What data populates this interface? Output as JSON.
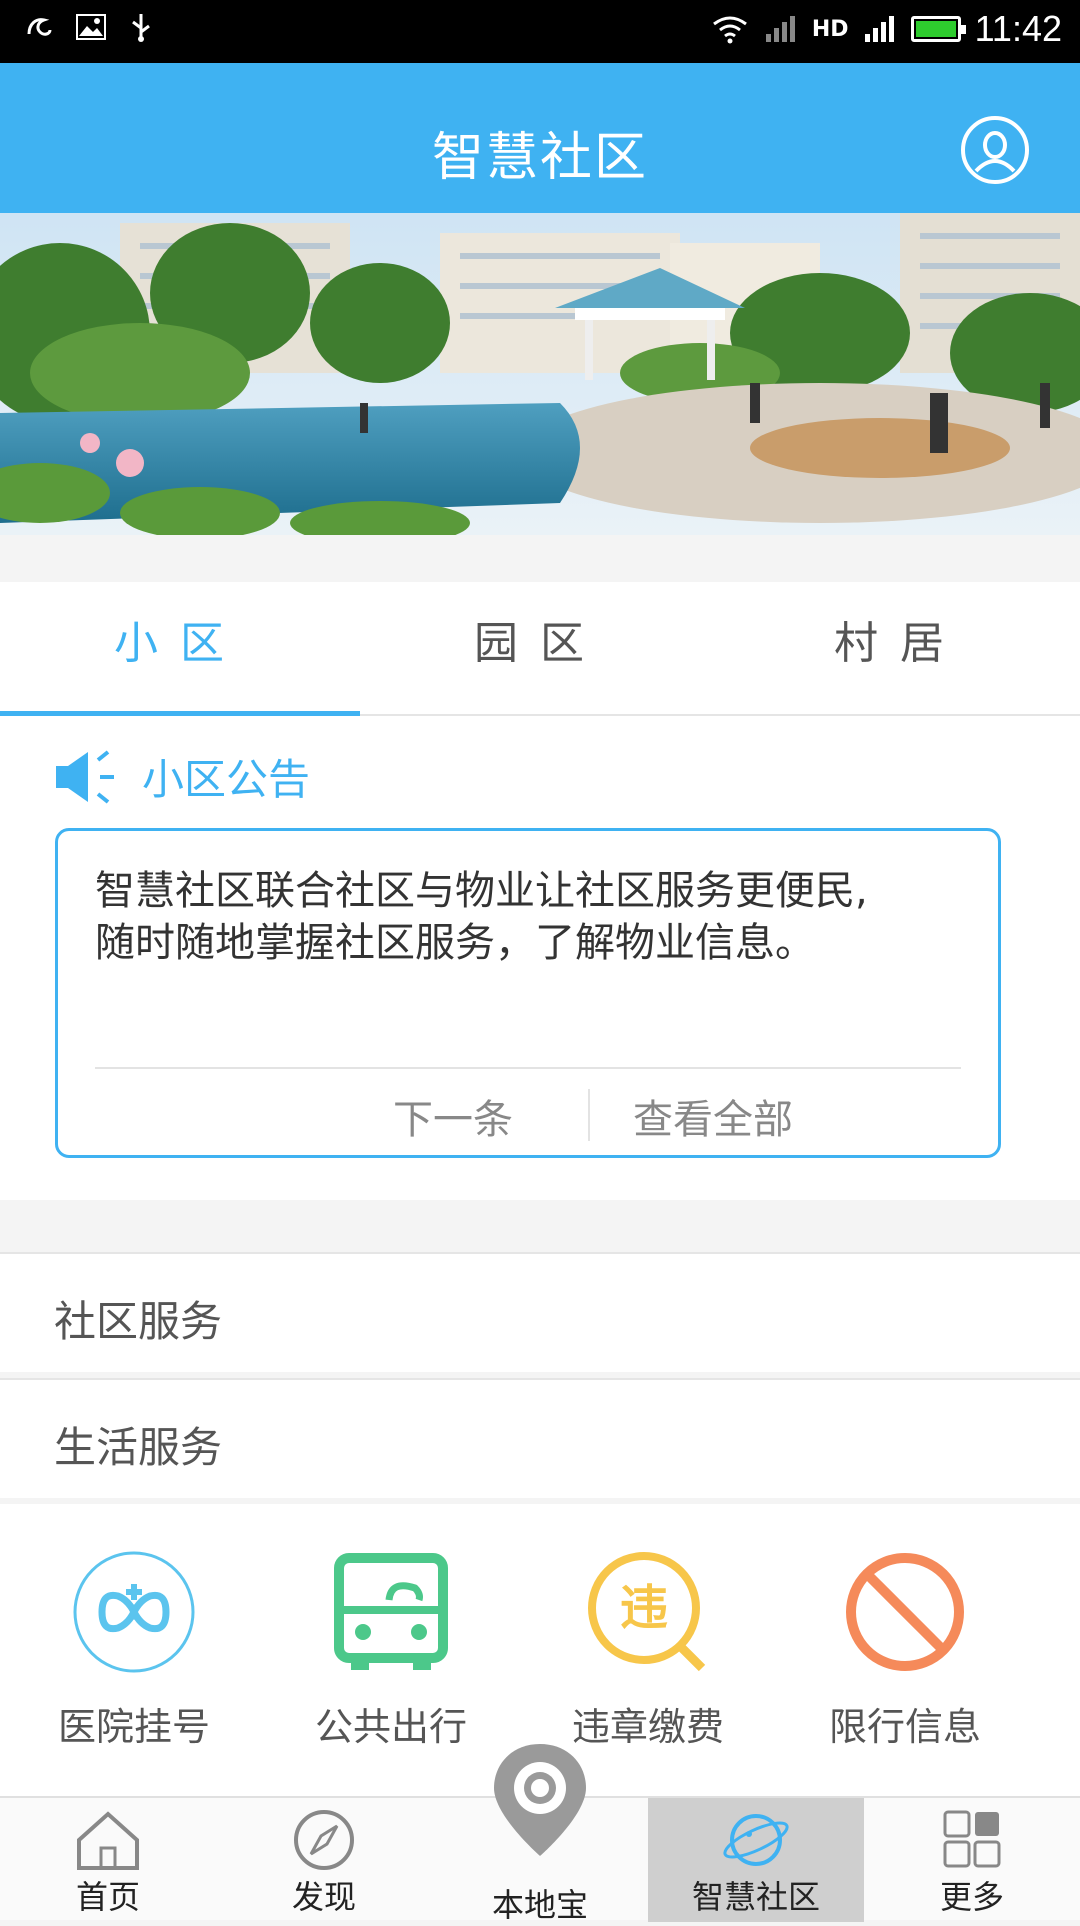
{
  "status_bar": {
    "time": "11:42",
    "network": "HD"
  },
  "header": {
    "title": "智慧社区"
  },
  "tabs": [
    {
      "label": "小区",
      "active": true
    },
    {
      "label": "园区",
      "active": false
    },
    {
      "label": "村居",
      "active": false
    }
  ],
  "notice": {
    "title": "小区公告",
    "line1": "智慧社区联合社区与物业让社区服务更便民,",
    "line2": "随时随地掌握社区服务，了解物业信息。",
    "next_label": "下一条",
    "view_all_label": "查看全部"
  },
  "sections": {
    "community_service": "社区服务",
    "life_service": "生活服务"
  },
  "services": [
    {
      "label": "医院挂号",
      "icon": "hospital-icon",
      "color": "#5bc4ee"
    },
    {
      "label": "公共出行",
      "icon": "bus-icon",
      "color": "#4cc88a"
    },
    {
      "label": "违章缴费",
      "icon": "violation-icon",
      "color": "#f7c64a",
      "glyph": "违"
    },
    {
      "label": "限行信息",
      "icon": "restriction-icon",
      "color": "#f58a5a"
    }
  ],
  "bottom_nav": [
    {
      "label": "首页",
      "icon": "home-icon"
    },
    {
      "label": "发现",
      "icon": "compass-icon"
    },
    {
      "label": "本地宝",
      "icon": "location-pin-icon"
    },
    {
      "label": "智慧社区",
      "icon": "planet-icon",
      "active": true
    },
    {
      "label": "更多",
      "icon": "grid-icon"
    }
  ],
  "colors": {
    "accent": "#3fb2f2",
    "status_bar": "#000000"
  }
}
